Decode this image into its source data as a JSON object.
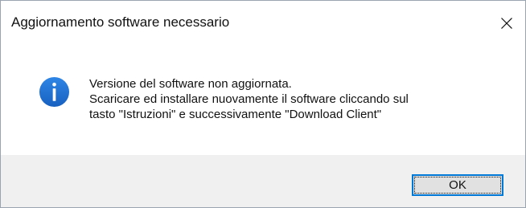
{
  "window": {
    "title": "Aggiornamento software necessario",
    "close_icon": "close-icon"
  },
  "content": {
    "icon": "info-icon",
    "icon_color": "#1e6fd0",
    "message_lines": [
      "Versione del software non aggiornata.",
      "Scaricare ed installare nuovamente il software cliccando sul",
      "tasto \"Istruzioni\" e successivamente \"Download Client\""
    ]
  },
  "footer": {
    "ok_label": "OK",
    "accent": "#0078d7"
  }
}
